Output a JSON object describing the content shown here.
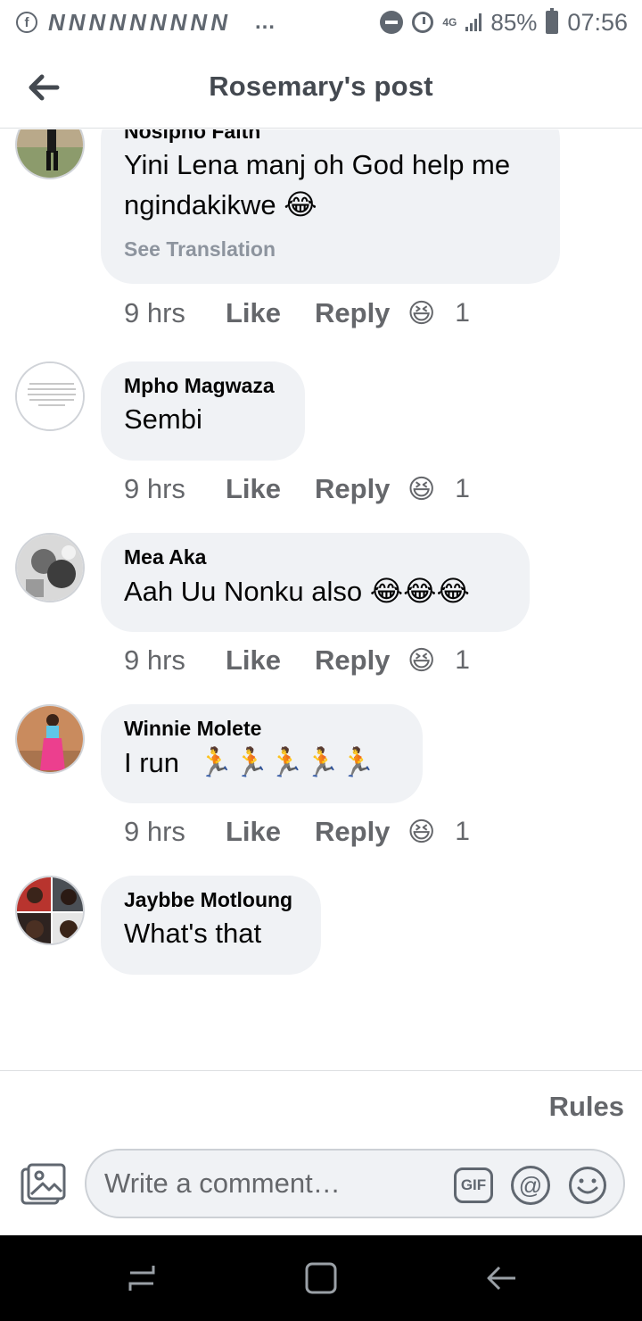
{
  "status_bar": {
    "notification_letters": "NNNNNNNNN",
    "more": "…",
    "network": "4G",
    "battery": "85%",
    "time": "07:56"
  },
  "header": {
    "title": "Rosemary's post",
    "back_icon": "arrow-left-icon"
  },
  "comments": [
    {
      "name": "Nosipho Faith",
      "text": "Yini Lena manj oh God help me ngindakikwe",
      "emoji": "😂",
      "see_translation": "See Translation",
      "time": "9 hrs",
      "like": "Like",
      "reply": "Reply",
      "reaction": "😆",
      "reaction_count": "1"
    },
    {
      "name": "Mpho Magwaza",
      "text": "Sembi",
      "emoji": "",
      "time": "9 hrs",
      "like": "Like",
      "reply": "Reply",
      "reaction": "😆",
      "reaction_count": "1"
    },
    {
      "name": "Mea Aka",
      "text": "Aah Uu Nonku also",
      "emoji": "😂😂😂",
      "time": "9 hrs",
      "like": "Like",
      "reply": "Reply",
      "reaction": "😆",
      "reaction_count": "1"
    },
    {
      "name": "Winnie Molete",
      "text": "I run",
      "emoji": "🏃🏃🏃🏃🏃",
      "time": "9 hrs",
      "like": "Like",
      "reply": "Reply",
      "reaction": "😆",
      "reaction_count": "1"
    },
    {
      "name": "Jaybbe Motloung",
      "text": "What's that",
      "emoji": ""
    }
  ],
  "footer": {
    "rules": "Rules",
    "composer_placeholder": "Write a comment…",
    "gif_label": "GIF",
    "at_label": "@"
  },
  "colors": {
    "bubble": "#f0f2f5",
    "text_secondary": "#65676b",
    "navbar": "#000000"
  }
}
